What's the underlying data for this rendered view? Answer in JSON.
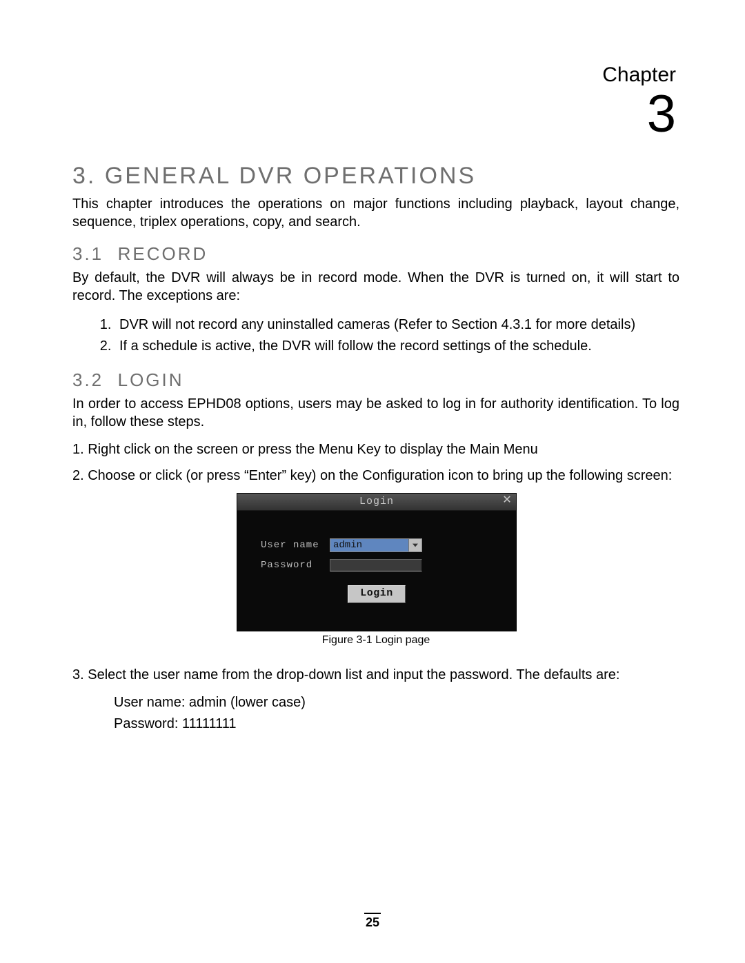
{
  "chapter": {
    "label": "Chapter",
    "number": "3"
  },
  "heading": {
    "number": "3.",
    "title": "GENERAL DVR OPERATIONS"
  },
  "intro": "This chapter introduces the operations on major functions including playback, layout change, sequence, triplex operations, copy, and search.",
  "section_record": {
    "number": "3.1",
    "title": "RECORD",
    "intro": "By default, the DVR will always be in record mode. When the DVR is turned on, it will start to record. The exceptions are:",
    "items": [
      "DVR will not record any uninstalled cameras (Refer to Section 4.3.1 for more details)",
      "If a schedule is active, the DVR will follow the record settings of the schedule."
    ]
  },
  "section_login": {
    "number": "3.2",
    "title": "LOGIN",
    "intro": "In order to access EPHD08 options, users may be asked to log in for authority identification. To log in, follow these steps.",
    "step1": "1. Right click on the screen or press the Menu Key to display the Main Menu",
    "step2": "2. Choose or click (or press “Enter” key) on the Configuration icon to bring up the following screen:",
    "step3": "3. Select the user name from the drop-down list and input the password. The defaults are:",
    "defaults": {
      "username_line": "User name: admin (lower case)",
      "password_line": "Password: 11111111"
    }
  },
  "login_dialog": {
    "title": "Login",
    "username_label": "User name",
    "username_value": "admin",
    "password_label": "Password",
    "button_label": "Login",
    "caption": "Figure 3-1 Login page"
  },
  "page_number": "25"
}
